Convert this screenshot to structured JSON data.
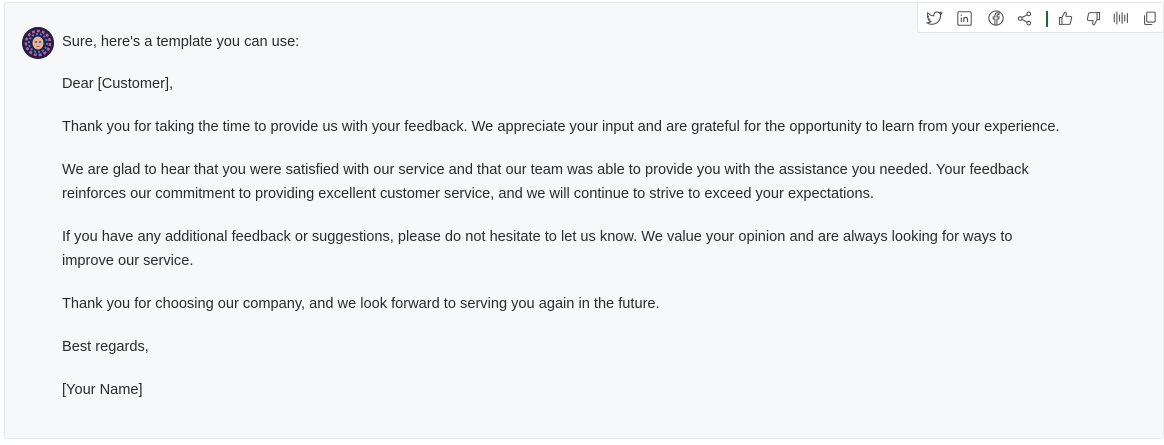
{
  "toolbar": {
    "icons": [
      "twitter-icon",
      "linkedin-icon",
      "facebook-icon",
      "share-icon",
      "thumbs-up-icon",
      "thumbs-down-icon",
      "audio-icon",
      "copy-icon"
    ],
    "separator_color": "#1f6b2e"
  },
  "message": {
    "intro": "Sure, here's a template you can use:",
    "salutation": "Dear [Customer],",
    "paragraphs": [
      "Thank you for taking the time to provide us with your feedback. We appreciate your input and are grateful for the opportunity to learn from your experience.",
      "We are glad to hear that you were satisfied with our service and that our team was able to provide you with the assistance you needed. Your feedback reinforces our commitment to providing excellent customer service, and we will continue to strive to exceed your expectations.",
      "If you have any additional feedback or suggestions, please do not hesitate to let us know. We value your opinion and are always looking for ways to improve our service.",
      "Thank you for choosing our company, and we look forward to serving you again in the future."
    ],
    "closing": "Best regards,",
    "signature": "[Your Name]"
  },
  "colors": {
    "card_background": "#f7f8fa",
    "text": "#2b2b2b",
    "icon": "#555555"
  }
}
